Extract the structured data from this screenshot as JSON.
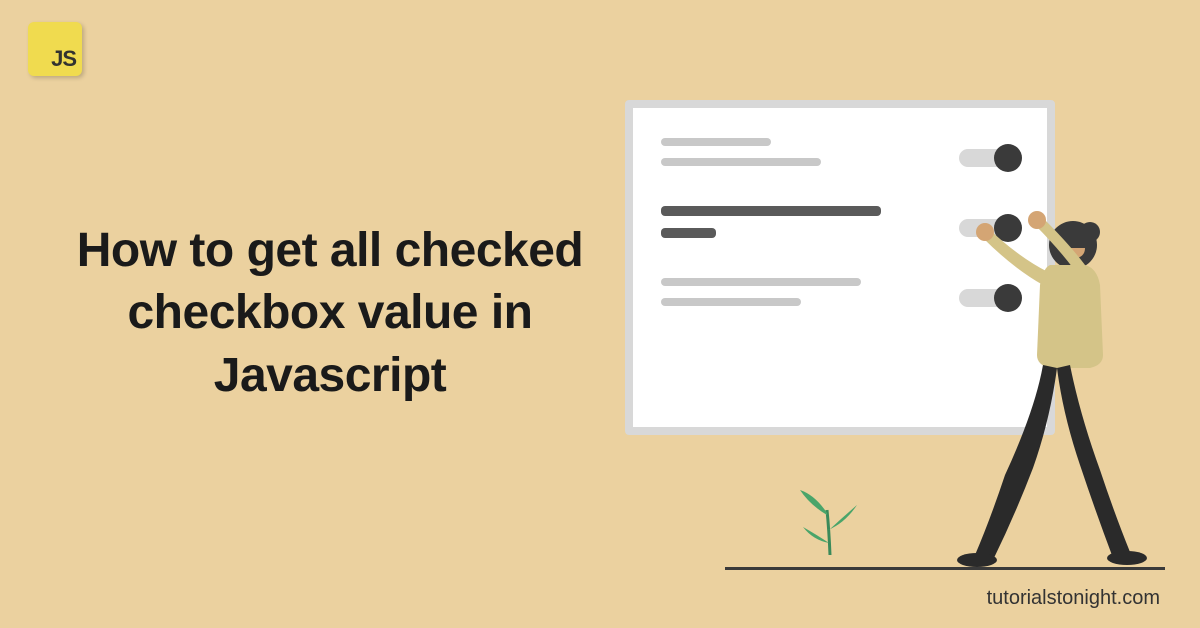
{
  "badge": {
    "text": "JS"
  },
  "title": "How to get all checked checkbox value in  Javascript",
  "watermark": "tutorialstonight.com"
}
